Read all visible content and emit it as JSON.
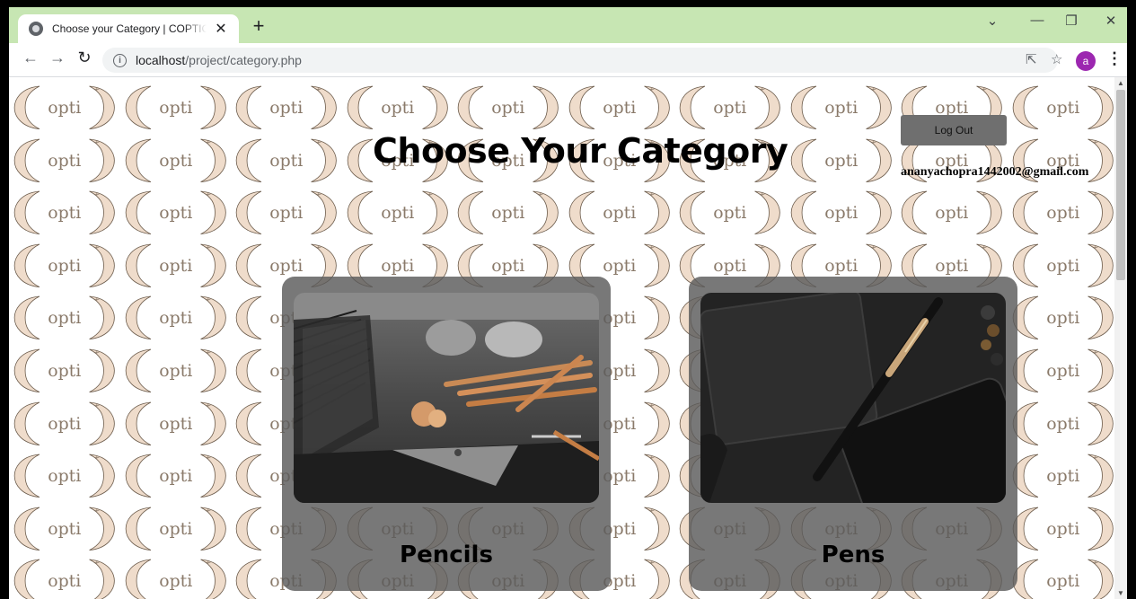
{
  "browser": {
    "tab_title": "Choose your Category | COPTICS",
    "tab_close": "✕",
    "new_tab": "+",
    "url_host": "localhost",
    "url_path": "/project/category.php",
    "profile_initial": "a"
  },
  "page": {
    "heading": "Choose Your Category",
    "logout_label": "Log Out",
    "user_email": "ananyachopra1442002@gmail.com",
    "logo_text": "opti",
    "categories": [
      {
        "label": "Pencils",
        "image": "pencils-photo"
      },
      {
        "label": "Pens",
        "image": "pen-photo"
      }
    ]
  },
  "colors": {
    "tab_strip": "#c7e6b3",
    "logo_crescent": "#efdccb",
    "card_overlay": "#5a5a5a",
    "logout_button": "#6f6f6f"
  }
}
